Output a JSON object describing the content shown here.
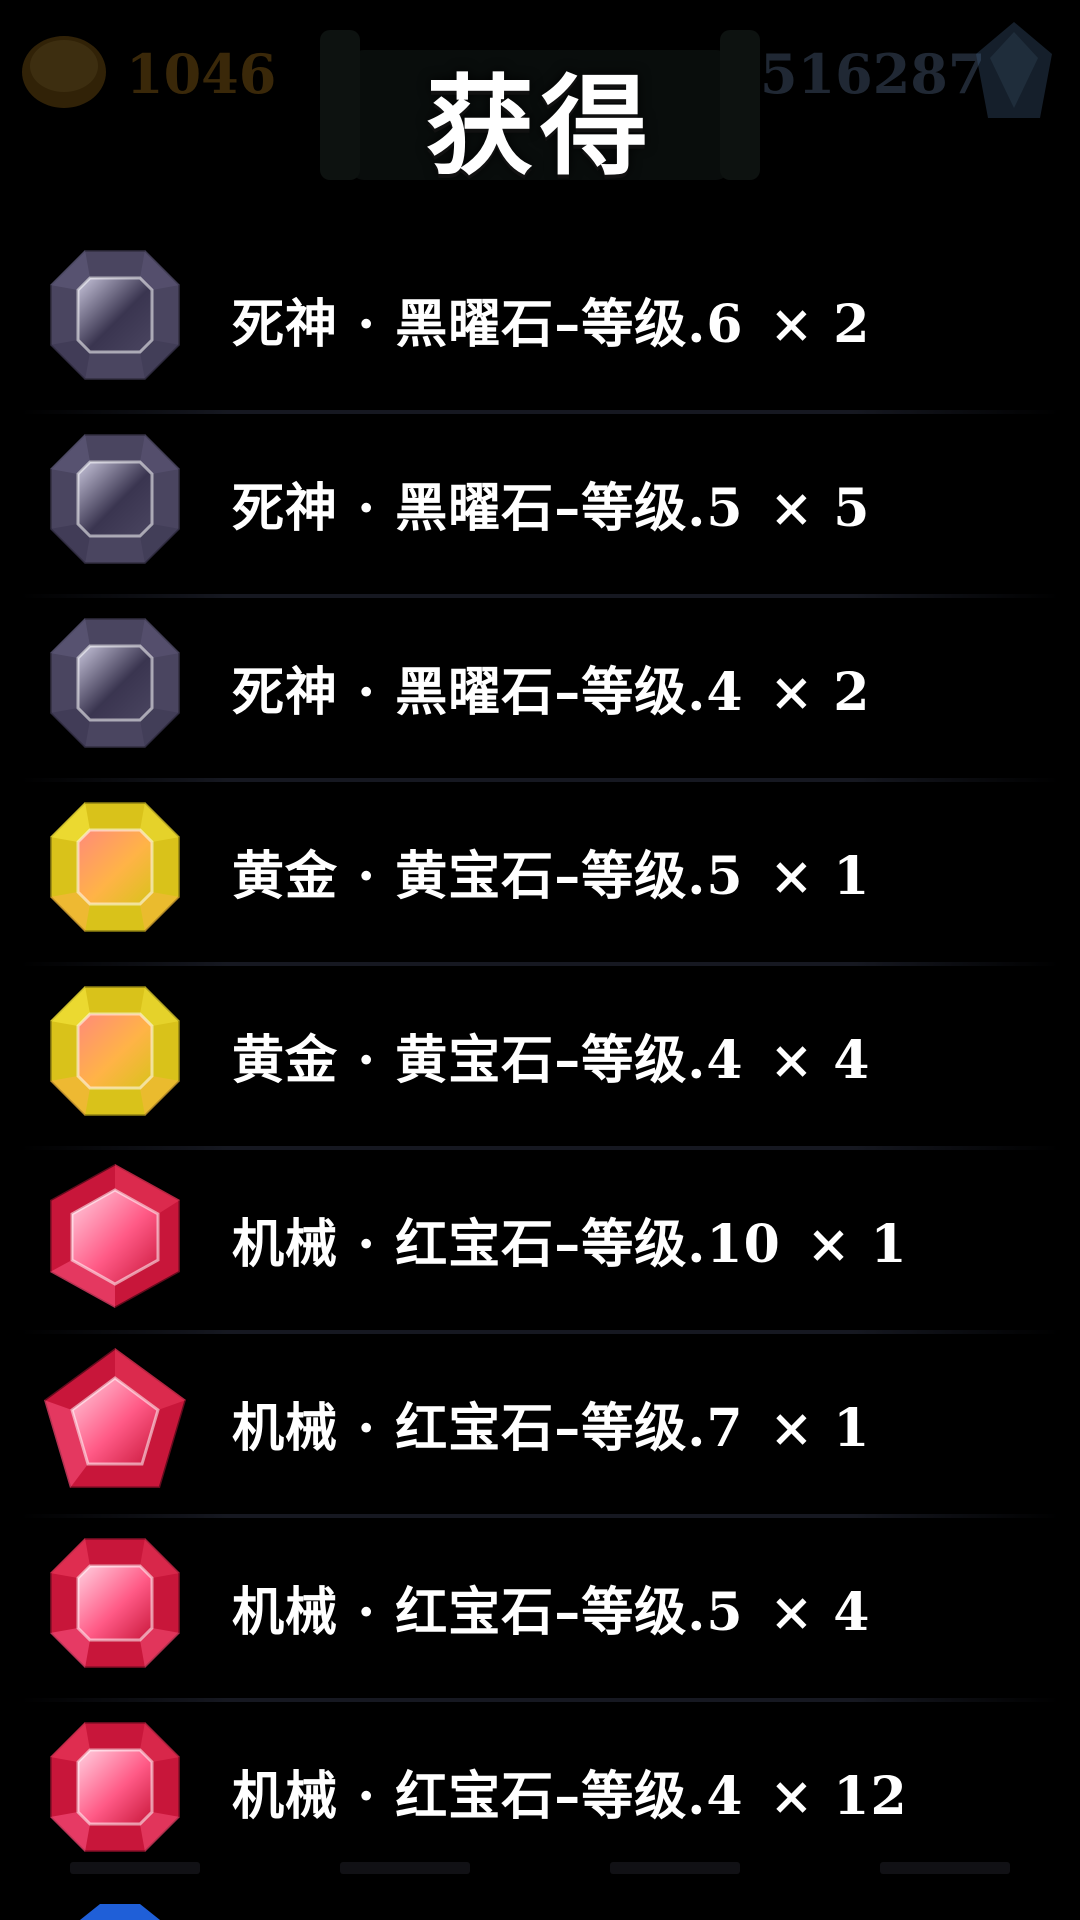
{
  "title": "获得",
  "hud": {
    "coins": "1046",
    "gems": "516287",
    "coin_icon": "coin-icon",
    "gem_icon": "crystal-icon"
  },
  "rewards": [
    {
      "name": "死神 · 黑曜石–等级.6",
      "qty": "× 2",
      "gem": "obsidian",
      "shape": "octagon"
    },
    {
      "name": "死神 · 黑曜石–等级.5",
      "qty": "× 5",
      "gem": "obsidian",
      "shape": "octagon"
    },
    {
      "name": "死神 · 黑曜石–等级.4",
      "qty": "× 2",
      "gem": "obsidian",
      "shape": "octagon"
    },
    {
      "name": "黄金 · 黄宝石–等级.5",
      "qty": "× 1",
      "gem": "topaz",
      "shape": "octagon"
    },
    {
      "name": "黄金 · 黄宝石–等级.4",
      "qty": "× 4",
      "gem": "topaz",
      "shape": "octagon"
    },
    {
      "name": "机械 · 红宝石–等级.10",
      "qty": "× 1",
      "gem": "ruby",
      "shape": "hexagon"
    },
    {
      "name": "机械 · 红宝石–等级.7",
      "qty": "× 1",
      "gem": "ruby",
      "shape": "pentagon"
    },
    {
      "name": "机械 · 红宝石–等级.5",
      "qty": "× 4",
      "gem": "ruby",
      "shape": "octagon"
    },
    {
      "name": "机械 · 红宝石–等级.4",
      "qty": "× 12",
      "gem": "ruby",
      "shape": "octagon"
    }
  ],
  "colors": {
    "obsidian": {
      "outer": "#4a4560",
      "mid": "#5d5878",
      "inner": "#3a3550",
      "hi": "#c9c6dc"
    },
    "topaz": {
      "outer": "#d9c21a",
      "mid": "#f2e23a",
      "inner": "#ffb347",
      "hi": "#ff8a7a"
    },
    "ruby": {
      "outer": "#c8163a",
      "mid": "#e8385a",
      "inner": "#ff5a86",
      "hi": "#ffd0e0"
    }
  }
}
